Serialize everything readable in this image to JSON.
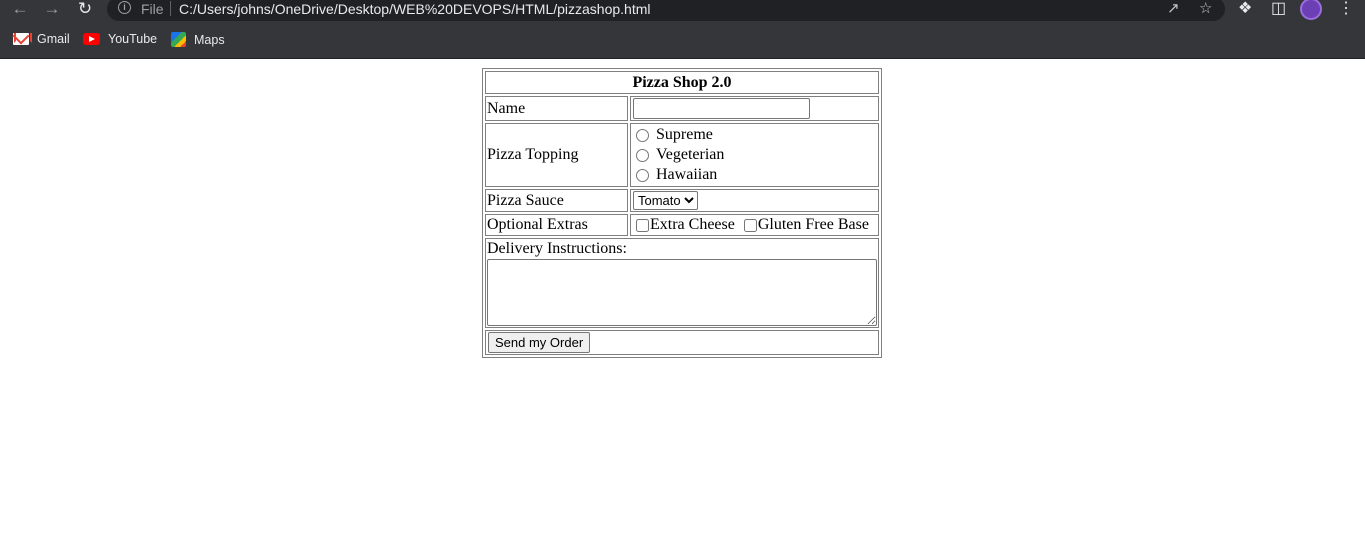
{
  "browser": {
    "back_icon": "arrow-left-icon",
    "forward_icon": "arrow-right-icon",
    "reload_icon": "reload-icon",
    "scheme_label": "File",
    "url": "C:/Users/johns/OneDrive/Desktop/WEB%20DEVOPS/HTML/pizzashop.html",
    "bookmarks": [
      {
        "label": "Gmail",
        "icon": "gmail-icon"
      },
      {
        "label": "YouTube",
        "icon": "youtube-icon"
      },
      {
        "label": "Maps",
        "icon": "maps-icon"
      }
    ]
  },
  "form": {
    "title": "Pizza Shop 2.0",
    "name_label": "Name",
    "name_value": "",
    "topping_label": "Pizza Topping",
    "toppings": [
      "Supreme",
      "Vegeterian",
      "Hawaiian"
    ],
    "sauce_label": "Pizza Sauce",
    "sauce_selected": "Tomato",
    "extras_label": "Optional Extras",
    "extras": [
      "Extra Cheese",
      "Gluten Free Base"
    ],
    "instructions_label": "Delivery Instructions:",
    "instructions_value": "",
    "submit_label": "Send my Order"
  }
}
